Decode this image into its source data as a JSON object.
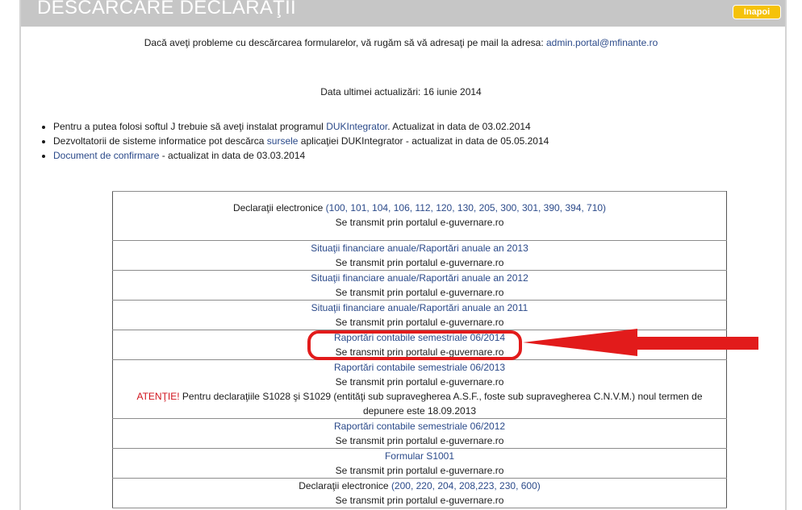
{
  "header": {
    "title": "DESCARCARE DECLARAŢII",
    "back_label": "Inapoi"
  },
  "contact": {
    "text": "Dacă aveţi probleme cu descărcarea formularelor, vă rugăm să vă adresaţi pe mail la adresa: ",
    "email": "admin.portal@mfinante.ro"
  },
  "update": {
    "text": "Data ultimei actualizări: 16 iunie 2014"
  },
  "bullets": [
    {
      "pre": "Pentru a putea folosi softul J trebuie să aveţi instalat programul ",
      "link": "DUKIntegrator",
      "post": ". Actualizat in data de 03.02.2014"
    },
    {
      "pre": "Dezvoltatorii de sisteme informatice pot descărca ",
      "link": "sursele",
      "post": " aplicaţiei DUKIntegrator  - actualizat in data de 05.05.2014"
    },
    {
      "pre": "",
      "link": "Document de confirmare",
      "post": " - actualizat in data de 03.03.2014"
    }
  ],
  "rows": [
    {
      "prefix": "Declaraţii electronice ",
      "link": "(100, 101, 104, 106, 112, 120, 130, 205, 300, 301, 390, 394, 710)",
      "note": "Se transmit prin portalul e-guvernare.ro"
    },
    {
      "prefix": "",
      "link": "Situaţii financiare anuale/Raportări anuale an 2013",
      "note": "Se transmit prin portalul e-guvernare.ro"
    },
    {
      "prefix": "",
      "link": "Situaţii financiare anuale/Raportări anuale an 2012",
      "note": "Se transmit prin portalul e-guvernare.ro"
    },
    {
      "prefix": "",
      "link": "Situaţii financiare anuale/Raportări anuale an 2011",
      "note": "Se transmit prin portalul e-guvernare.ro"
    },
    {
      "prefix": "",
      "link": "Raportări contabile semestriale 06/2014",
      "note": "Se transmit prin portalul e-guvernare.ro"
    },
    {
      "prefix": "",
      "link": "Raportări contabile semestriale 06/2013",
      "note": "Se transmit prin portalul e-guvernare.ro",
      "alert": "ATENŢIE!",
      "alert_text": " Pentru declaraţiile S1028 şi S1029 (entităţi sub supravegherea A.S.F., foste sub supravegherea C.N.V.M.) noul termen de depunere este 18.09.2013"
    },
    {
      "prefix": "",
      "link": "Raportări contabile semestriale 06/2012",
      "note": "Se transmit prin portalul e-guvernare.ro"
    },
    {
      "prefix": "",
      "link": "Formular S1001",
      "note": "Se transmit prin portalul e-guvernare.ro"
    },
    {
      "prefix": "Declaraţii electronice ",
      "link": "(200, 220, 204, 208,223, 230, 600)",
      "note": "Se transmit prin portalul e-guvernare.ro"
    }
  ],
  "annotation": {
    "color": "#e21b1b"
  }
}
